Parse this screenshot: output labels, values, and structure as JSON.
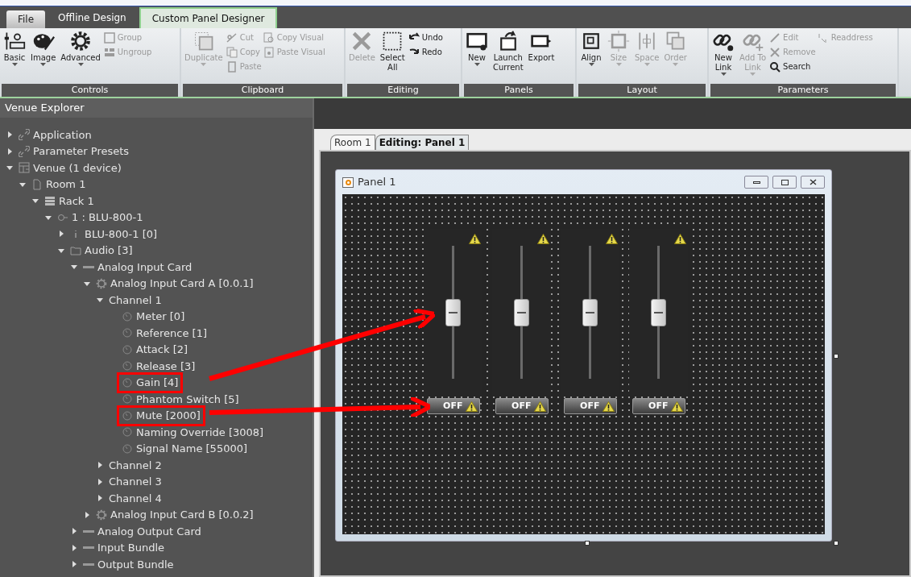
{
  "app_tabs": [
    {
      "label": "File",
      "kind": "file",
      "selected": false
    },
    {
      "label": "Offline Design",
      "kind": "tab",
      "selected": false
    },
    {
      "label": "Custom Panel Designer",
      "kind": "tab",
      "selected": true
    }
  ],
  "ribbon": [
    {
      "label": "Controls",
      "columns": [
        {
          "kind": "large",
          "items": [
            {
              "label": "Basic",
              "disabled": false,
              "dropdown": true
            }
          ]
        },
        {
          "kind": "large",
          "items": [
            {
              "label": "Image",
              "disabled": false,
              "dropdown": true
            }
          ]
        },
        {
          "kind": "large",
          "items": [
            {
              "label": "Advanced",
              "disabled": false,
              "dropdown": true
            }
          ]
        },
        {
          "kind": "stack",
          "items": [
            {
              "label": "Group",
              "disabled": true
            },
            {
              "label": "Ungroup",
              "disabled": true
            }
          ]
        }
      ]
    },
    {
      "label": "Clipboard",
      "columns": [
        {
          "kind": "large",
          "items": [
            {
              "label": "Duplicate",
              "disabled": true,
              "dropdown": true
            }
          ]
        },
        {
          "kind": "stack",
          "items": [
            {
              "label": "Cut",
              "disabled": true
            },
            {
              "label": "Copy",
              "disabled": true
            },
            {
              "label": "Paste",
              "disabled": true
            }
          ]
        },
        {
          "kind": "stack",
          "items": [
            {
              "label": "Copy Visual",
              "disabled": true
            },
            {
              "label": "Paste Visual",
              "disabled": true
            }
          ]
        }
      ]
    },
    {
      "label": "Editing",
      "columns": [
        {
          "kind": "large",
          "items": [
            {
              "label": "Delete",
              "disabled": true,
              "dropdown": false
            }
          ]
        },
        {
          "kind": "large",
          "items": [
            {
              "label": "Select\nAll",
              "disabled": false,
              "dropdown": false
            }
          ]
        },
        {
          "kind": "stack",
          "items": [
            {
              "label": "Undo",
              "disabled": false
            },
            {
              "label": "Redo",
              "disabled": false
            }
          ]
        }
      ]
    },
    {
      "label": "Panels",
      "columns": [
        {
          "kind": "large",
          "items": [
            {
              "label": "New",
              "disabled": false,
              "dropdown": true
            }
          ]
        },
        {
          "kind": "large",
          "items": [
            {
              "label": "Launch\nCurrent",
              "disabled": false,
              "dropdown": false
            }
          ]
        },
        {
          "kind": "large",
          "items": [
            {
              "label": "Export",
              "disabled": false,
              "dropdown": false
            }
          ]
        }
      ]
    },
    {
      "label": "Layout",
      "columns": [
        {
          "kind": "large",
          "items": [
            {
              "label": "Align",
              "disabled": false,
              "dropdown": true
            }
          ]
        },
        {
          "kind": "large",
          "items": [
            {
              "label": "Size",
              "disabled": true,
              "dropdown": true
            }
          ]
        },
        {
          "kind": "large",
          "items": [
            {
              "label": "Space",
              "disabled": true,
              "dropdown": true
            }
          ]
        },
        {
          "kind": "large",
          "items": [
            {
              "label": "Order",
              "disabled": true,
              "dropdown": true
            }
          ]
        }
      ]
    },
    {
      "label": "Parameters",
      "columns": [
        {
          "kind": "large",
          "items": [
            {
              "label": "New\nLink",
              "disabled": false,
              "dropdown": true
            }
          ]
        },
        {
          "kind": "large",
          "items": [
            {
              "label": "Add To\nLink",
              "disabled": true,
              "dropdown": true
            }
          ]
        },
        {
          "kind": "stack",
          "items": [
            {
              "label": "Edit",
              "disabled": true
            },
            {
              "label": "Remove",
              "disabled": true
            },
            {
              "label": "Search",
              "disabled": false
            }
          ]
        },
        {
          "kind": "stack",
          "items": [
            {
              "label": "Readdress",
              "disabled": true
            }
          ]
        }
      ]
    }
  ],
  "explorer": {
    "title": "Venue Explorer",
    "tree": [
      {
        "label": "Application",
        "kind": "link",
        "expanded": false
      },
      {
        "label": "Parameter Presets",
        "kind": "link",
        "expanded": false
      },
      {
        "label": "Venue (1 device)",
        "kind": "venue",
        "expanded": true,
        "children": [
          {
            "label": "Room 1",
            "kind": "room",
            "expanded": true,
            "children": [
              {
                "label": "Rack 1",
                "kind": "rack",
                "expanded": true,
                "children": [
                  {
                    "label": "1 : BLU-800-1",
                    "kind": "device",
                    "expanded": true,
                    "children": [
                      {
                        "label": "BLU-800-1 [0]",
                        "kind": "info",
                        "expanded": false
                      },
                      {
                        "label": "Audio [3]",
                        "kind": "folder",
                        "expanded": true,
                        "children": [
                          {
                            "label": "Analog Input Card",
                            "kind": "card",
                            "expanded": true,
                            "children": [
                              {
                                "label": "Analog Input Card A [0.0.1]",
                                "kind": "gear",
                                "expanded": true,
                                "children": [
                                  {
                                    "label": "Channel 1",
                                    "expanded": true,
                                    "children": [
                                      {
                                        "label": "Meter [0]",
                                        "kind": "param",
                                        "highlighted": false
                                      },
                                      {
                                        "label": "Reference [1]",
                                        "kind": "param",
                                        "highlighted": false
                                      },
                                      {
                                        "label": "Attack [2]",
                                        "kind": "param",
                                        "highlighted": false
                                      },
                                      {
                                        "label": "Release [3]",
                                        "kind": "param",
                                        "highlighted": false
                                      },
                                      {
                                        "label": "Gain [4]",
                                        "kind": "param",
                                        "highlighted": true
                                      },
                                      {
                                        "label": "Phantom Switch [5]",
                                        "kind": "param",
                                        "highlighted": false
                                      },
                                      {
                                        "label": "Mute [2000]",
                                        "kind": "param",
                                        "highlighted": true
                                      },
                                      {
                                        "label": "Naming Override [3008]",
                                        "kind": "param",
                                        "highlighted": false
                                      },
                                      {
                                        "label": "Signal Name [55000]",
                                        "kind": "param",
                                        "highlighted": false
                                      }
                                    ]
                                  },
                                  {
                                    "label": "Channel 2",
                                    "expanded": false
                                  },
                                  {
                                    "label": "Channel 3",
                                    "expanded": false
                                  },
                                  {
                                    "label": "Channel 4",
                                    "expanded": false
                                  }
                                ]
                              },
                              {
                                "label": "Analog Input Card B [0.0.2]",
                                "kind": "gear",
                                "expanded": false
                              }
                            ]
                          },
                          {
                            "label": "Analog Output Card",
                            "kind": "card",
                            "expanded": false
                          },
                          {
                            "label": "Input Bundle",
                            "kind": "card",
                            "expanded": false
                          },
                          {
                            "label": "Output Bundle",
                            "kind": "card",
                            "expanded": false
                          }
                        ]
                      }
                    ]
                  }
                ]
              }
            ]
          }
        ]
      }
    ]
  },
  "doc_tabs": [
    {
      "label": "Room 1",
      "selected": false
    },
    {
      "label": "Editing: Panel 1",
      "selected": true
    }
  ],
  "panel": {
    "title": "Panel 1",
    "channels": [
      {
        "level": 0.5,
        "mute_label": "OFF"
      },
      {
        "level": 0.5,
        "mute_label": "OFF"
      },
      {
        "level": 0.5,
        "mute_label": "OFF"
      },
      {
        "level": 0.5,
        "mute_label": "OFF"
      }
    ]
  }
}
